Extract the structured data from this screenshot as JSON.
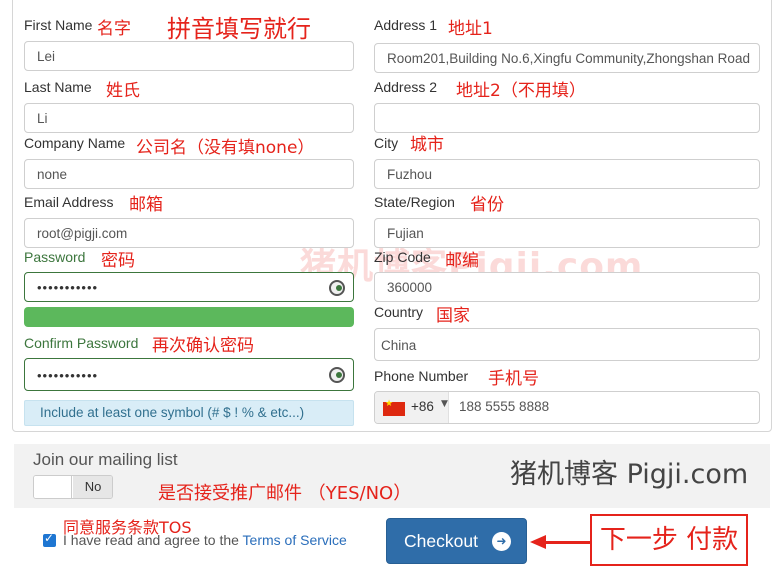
{
  "form": {
    "first_name": {
      "label": "First Name",
      "note": "名字",
      "value": "Lei"
    },
    "headline_note": "拼音填写就行",
    "last_name": {
      "label": "Last Name",
      "note": "姓氏",
      "value": "Li"
    },
    "company": {
      "label": "Company Name",
      "note": "公司名（没有填none）",
      "value": "none"
    },
    "email": {
      "label": "Email Address",
      "note": "邮箱",
      "value": "root@pigji.com"
    },
    "password": {
      "label": "Password",
      "note": "密码",
      "value": "•••••••••••"
    },
    "password_strength_pct": 100,
    "confirm_password": {
      "label": "Confirm Password",
      "note": "再次确认密码",
      "value": "•••••••••••"
    },
    "password_hint": "Include at least one symbol (# $ ! % & etc...)",
    "address1": {
      "label": "Address 1",
      "note": "地址1",
      "value": "Room201,Building No.6,Xingfu Community,Zhongshan Road"
    },
    "address2": {
      "label": "Address 2",
      "note": "地址2（不用填）",
      "value": ""
    },
    "city": {
      "label": "City",
      "note": "城市",
      "value": "Fuzhou"
    },
    "state": {
      "label": "State/Region",
      "note": "省份",
      "value": "Fujian"
    },
    "zip": {
      "label": "Zip Code",
      "note": "邮编",
      "value": "360000"
    },
    "country": {
      "label": "Country",
      "note": "国家",
      "value": "China"
    },
    "phone": {
      "label": "Phone Number",
      "note": "手机号",
      "dial_code": "+86",
      "value": "188 5555 8888"
    }
  },
  "mailing": {
    "title": "Join our mailing list",
    "toggle_value": "No",
    "note": "是否接受推广邮件 （YES/NO）"
  },
  "watermark": {
    "small": "猪机博客 Pigji.com",
    "large": "猪机博客Pigji.com"
  },
  "tos": {
    "note": "同意服务条款TOS",
    "text": "I have read and agree to the ",
    "link": "Terms of Service",
    "checked": true
  },
  "checkout": {
    "label": "Checkout",
    "icon": "arrow-right-circle-icon"
  },
  "next_step_note": "下一步 付款",
  "colors": {
    "success_green": "#3c763d",
    "strength_bar": "#5cb85c",
    "checkout_blue": "#2f6da9",
    "annotation_red": "#e5231b",
    "hint_bg": "#d9edf7"
  }
}
